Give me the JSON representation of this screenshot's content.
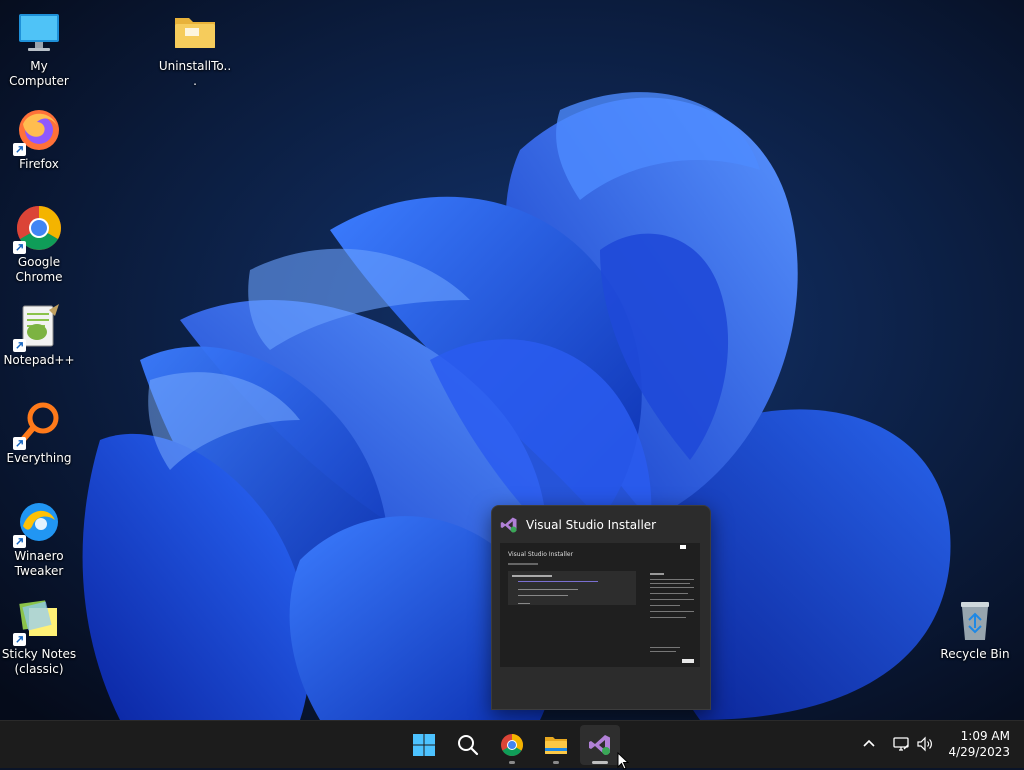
{
  "desktop": {
    "icons": [
      {
        "label": "My Computer",
        "icon": "monitor-icon"
      },
      {
        "label": "UninstallTo...",
        "icon": "folder-icon"
      },
      {
        "label": "Firefox",
        "icon": "firefox-icon",
        "shortcut": true
      },
      {
        "label": "Google Chrome",
        "icon": "chrome-icon",
        "shortcut": true
      },
      {
        "label": "Notepad++",
        "icon": "notepadpp-icon",
        "shortcut": true
      },
      {
        "label": "Everything",
        "icon": "everything-icon",
        "shortcut": true
      },
      {
        "label": "Winaero Tweaker",
        "icon": "winaero-icon",
        "shortcut": true
      },
      {
        "label": "Sticky Notes (classic)",
        "icon": "sticky-notes-icon",
        "shortcut": true
      },
      {
        "label": "Recycle Bin",
        "icon": "recycle-bin-icon"
      }
    ]
  },
  "preview": {
    "title": "Visual Studio Installer",
    "thumbnail_heading": "Visual Studio Installer"
  },
  "taskbar": {
    "buttons": [
      {
        "name": "start-button",
        "icon": "windows-logo-icon"
      },
      {
        "name": "search-button",
        "icon": "search-icon"
      },
      {
        "name": "chrome-taskbar-button",
        "icon": "chrome-icon"
      },
      {
        "name": "file-explorer-taskbar-button",
        "icon": "folder-icon"
      },
      {
        "name": "visual-studio-installer-taskbar-button",
        "icon": "visual-studio-icon",
        "active": true
      }
    ],
    "tray": {
      "icons": [
        "chevron-up-icon",
        "network-icon",
        "volume-icon"
      ]
    },
    "clock": {
      "time": "1:09 AM",
      "date": "4/29/2023"
    }
  },
  "colors": {
    "taskbar_bg": "#1c1c1c",
    "accent": "#0078d4",
    "wallpaper_blue": "#1a4fd6"
  }
}
